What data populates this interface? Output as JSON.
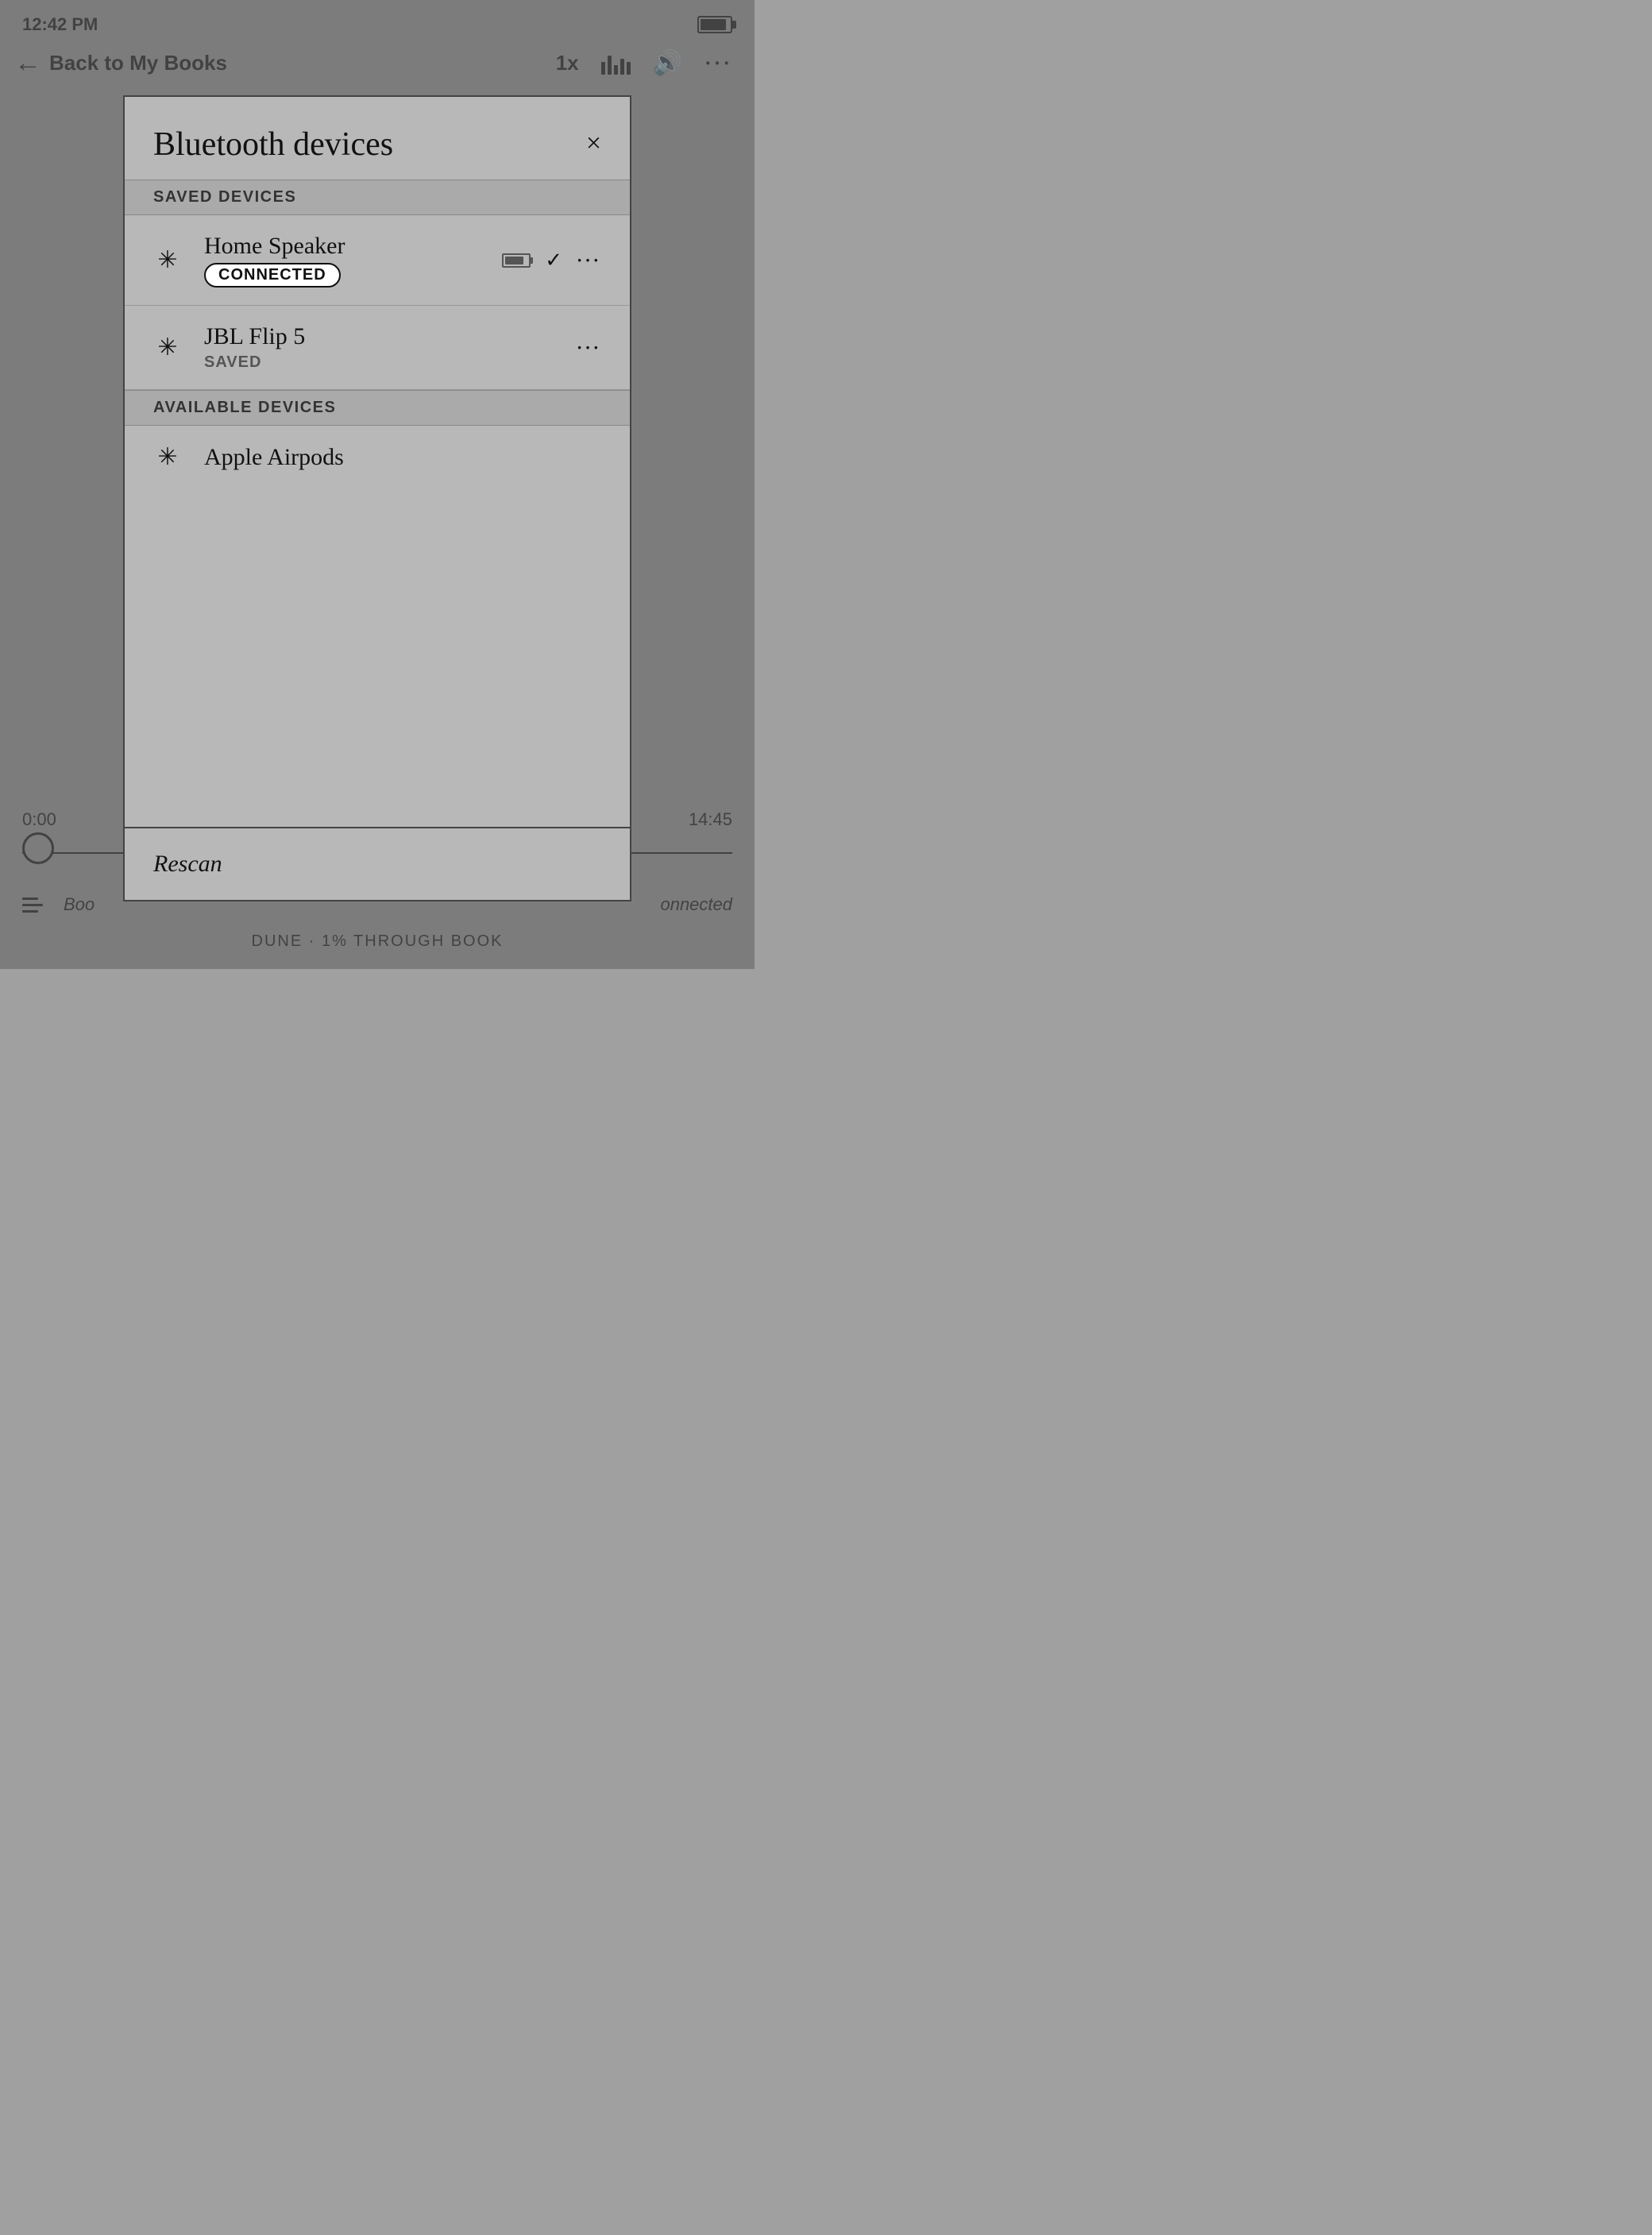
{
  "statusBar": {
    "time": "12:42 PM"
  },
  "navBar": {
    "backLabel": "Back to My Books",
    "speed": "1x",
    "moreIcon": "···"
  },
  "player": {
    "timeLeft": "0:00",
    "timeRight": "14:45",
    "bookTitle": "DUNE · 1% THROUGH BOOK",
    "rescanLabel": "Rescan",
    "connectedLabel": "onnected"
  },
  "modal": {
    "title": "Bluetooth devices",
    "closeIcon": "×",
    "savedSection": "SAVED DEVICES",
    "availableSection": "AVAILABLE DEVICES",
    "devices": {
      "saved": [
        {
          "name": "Home Speaker",
          "status": "connected",
          "statusLabel": "CONNECTED",
          "hasBattery": true,
          "hasCheck": true
        },
        {
          "name": "JBL Flip 5",
          "status": "saved",
          "statusLabel": "SAVED",
          "hasBattery": false,
          "hasCheck": false
        }
      ],
      "available": [
        {
          "name": "Apple Airpods",
          "status": "none",
          "statusLabel": "",
          "hasBattery": false,
          "hasCheck": false
        }
      ]
    }
  }
}
